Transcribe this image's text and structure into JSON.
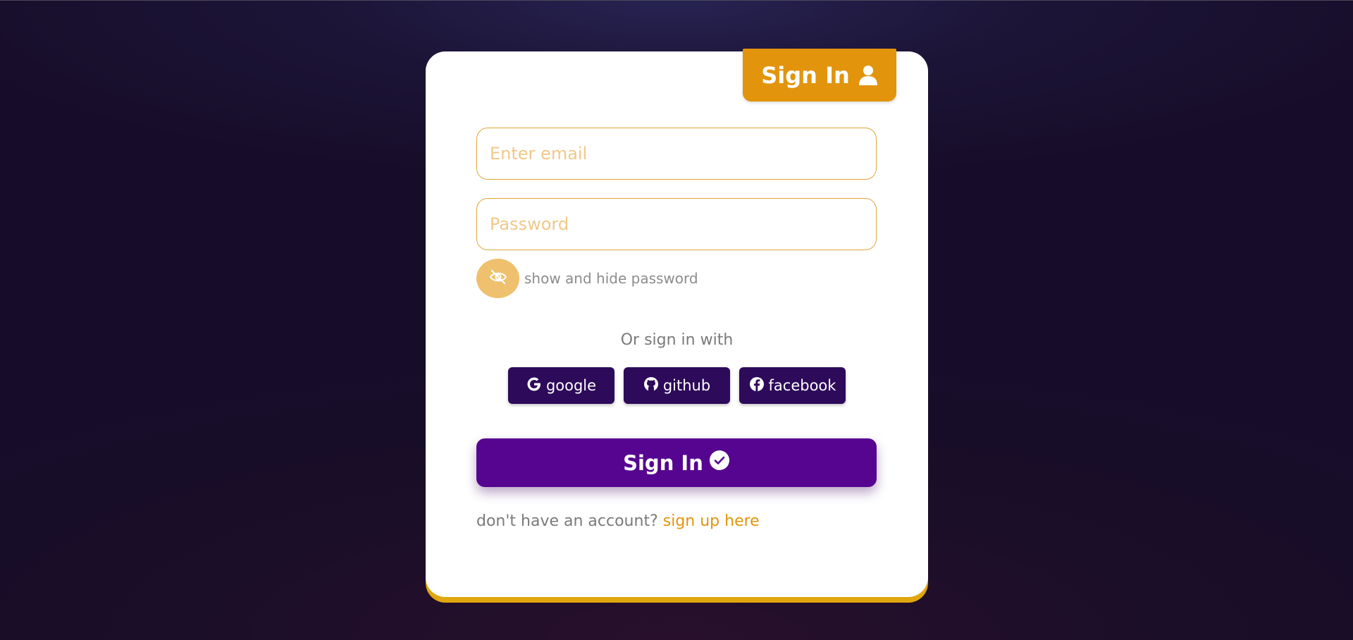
{
  "header": {
    "title": "Sign In",
    "icon": "user-icon",
    "color": "#e2940c"
  },
  "form": {
    "email_placeholder": "Enter email",
    "email_value": "",
    "password_placeholder": "Password",
    "password_value": "",
    "toggle_label": "show and hide password",
    "toggle_icon": "eye-slash-icon"
  },
  "social": {
    "heading": "Or sign in with",
    "buttons": [
      {
        "label": "google",
        "icon": "google-icon"
      },
      {
        "label": "github",
        "icon": "github-icon"
      },
      {
        "label": "facebook",
        "icon": "facebook-icon"
      }
    ],
    "color": "#2d0a5a"
  },
  "submit": {
    "label": "Sign In",
    "icon": "check-circle-icon",
    "color": "#560590"
  },
  "footer": {
    "text": "don't have an account?",
    "link_label": "sign up here"
  },
  "colors": {
    "accent": "#e2940c",
    "primary": "#560590",
    "card_border": "#e0a60e"
  }
}
